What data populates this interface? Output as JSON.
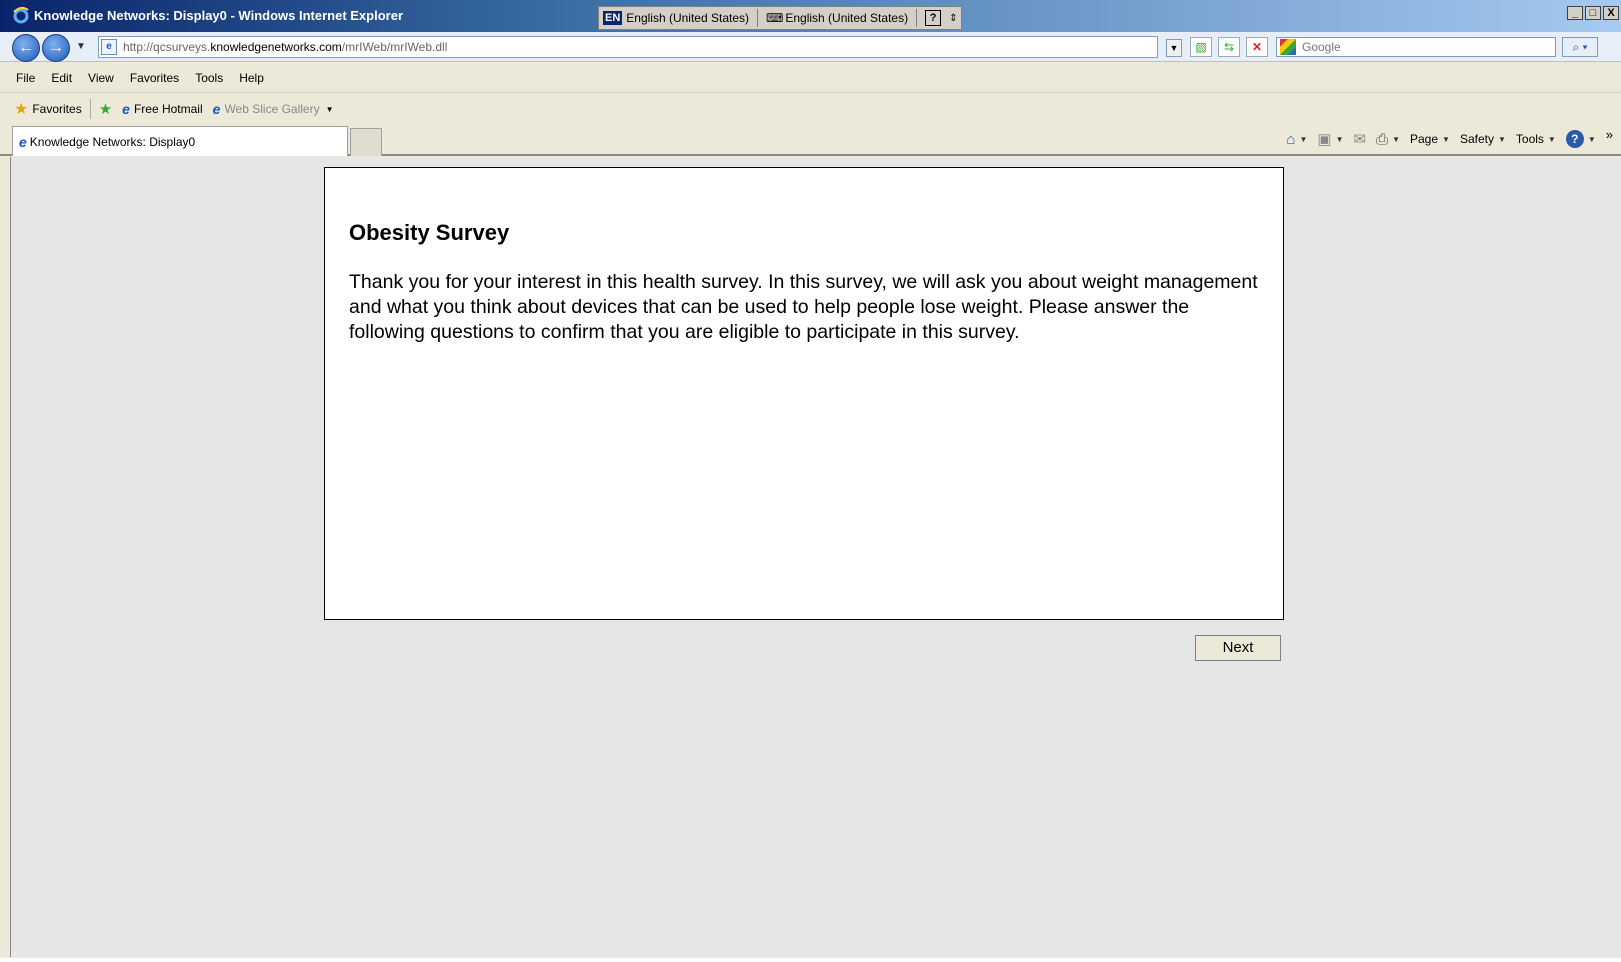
{
  "window": {
    "title": "Knowledge Networks: Display0 - Windows Internet Explorer",
    "language_indicator": "EN",
    "language_1": "English (United States)",
    "language_2": "English (United States)",
    "help_glyph": "?",
    "controls": [
      "_",
      "□",
      "X"
    ]
  },
  "address_bar": {
    "url_prefix": "http://qcsurveys.",
    "url_domain": "knowledgenetworks.com",
    "url_path": "/mrIWeb/mrIWeb.dll",
    "search_placeholder": "Google"
  },
  "menu": {
    "items": [
      "File",
      "Edit",
      "View",
      "Favorites",
      "Tools",
      "Help"
    ]
  },
  "favorites_bar": {
    "favorites_label": "Favorites",
    "link_1": "Free Hotmail",
    "link_2": "Web Slice Gallery"
  },
  "tabs": {
    "active_tab_label": "Knowledge Networks: Display0"
  },
  "command_bar": {
    "page_label": "Page",
    "safety_label": "Safety",
    "tools_label": "Tools",
    "more": "»"
  },
  "survey": {
    "title": "Obesity Survey",
    "body": "Thank you for your interest in this health survey. In this survey, we will ask you about weight management and what you think about devices that can be used to help people lose weight. Please answer the following questions to confirm that you are eligible to participate in this survey.",
    "next_label": "Next"
  },
  "colors": {
    "title_bar": "#0a246a",
    "content_bg": "#e6e6e6",
    "panel_bg": "#ffffff"
  }
}
